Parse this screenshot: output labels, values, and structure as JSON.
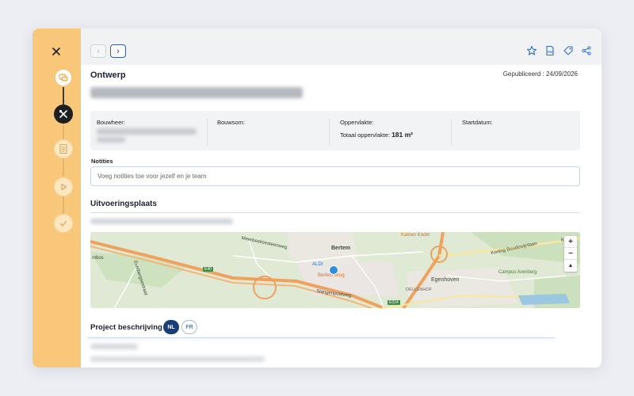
{
  "toolbar": {
    "prev_icon": "chevron-left-icon",
    "next_icon": "chevron-right-icon",
    "actions": [
      "star-icon",
      "pdf-icon",
      "tag-icon",
      "share-icon",
      "trash-icon"
    ],
    "prev_glyph": "‹",
    "next_glyph": "›"
  },
  "sidebar": {
    "close_icon": "close-icon",
    "steps": [
      "chat-icon",
      "tools-icon",
      "document-icon",
      "play-icon",
      "check-icon"
    ]
  },
  "header": {
    "section": "Ontwerp",
    "published": "Gepubliceerd : 24/09/2026"
  },
  "info": {
    "bouwheer_label": "Bouwheer:",
    "bouwsom_label": "Bouwsom:",
    "oppervlakte_label": "Oppervlakte:",
    "totaal_label": "Totaal oppervlakte:",
    "totaal_value": "181 m²",
    "startdatum_label": "Startdatum:"
  },
  "notes": {
    "label": "Notities",
    "placeholder": "Voeg notities toe voor jezelf en je team"
  },
  "location": {
    "title": "Uitvoeringsplaats"
  },
  "map": {
    "labels": {
      "bertem": "Bertem",
      "aldi": "ALDI",
      "bertem_brug": "Bertem Brug",
      "egenhoven": "Egenhoven",
      "dellenhof": "DELLENHOF",
      "meerbeek": "Meerbeeksesteenweg",
      "koning": "Koning Boudewijnlaan",
      "katrien": "Katrien Kookt",
      "campus": "Campus Arenberg",
      "slangenpoelweg": "Slangenpoelweg",
      "everberg": "Everbergsestraat",
      "bimbos": "mbos",
      "road_e40": "E40",
      "road_e314": "E314",
      "koning_short": "Koning"
    },
    "zoom_in": "+",
    "zoom_out": "−",
    "compass": "▲",
    "colors": {
      "land": "#dde8d2",
      "highway": "#f0a25c",
      "road": "#f6e7a6",
      "water": "#9cc7e0",
      "pin": "#2d8fd5"
    }
  },
  "description": {
    "title": "Project beschrijving",
    "lang_nl": "NL",
    "lang_fr": "FR"
  }
}
